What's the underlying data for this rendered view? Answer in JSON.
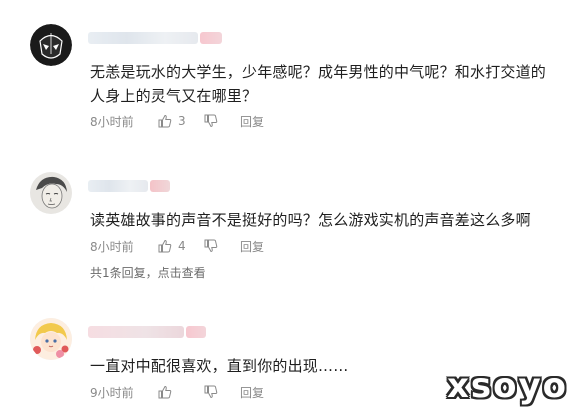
{
  "comments": [
    {
      "avatar_icon": "masked-hero-avatar",
      "text": "无恙是玩水的大学生，少年感呢？成年男性的中气呢？和水打交道的人身上的灵气又在哪里？",
      "time": "8小时前",
      "likes": "3",
      "reply_label": "回复"
    },
    {
      "avatar_icon": "sketched-man-avatar",
      "text": "读英雄故事的声音不是挺好的吗？怎么游戏实机的声音差这么多啊",
      "time": "8小时前",
      "likes": "4",
      "reply_label": "回复",
      "replies_summary": "共1条回复，点击查看"
    },
    {
      "avatar_icon": "anime-character-avatar",
      "text": "一直对中配很喜欢，直到你的出现……",
      "time": "9小时前",
      "likes": "",
      "reply_label": "回复"
    }
  ],
  "watermark": "xsoyo",
  "colors": {
    "meta_gray": "#8a8a8a",
    "name_tag_pink": "#f7c7cf"
  }
}
